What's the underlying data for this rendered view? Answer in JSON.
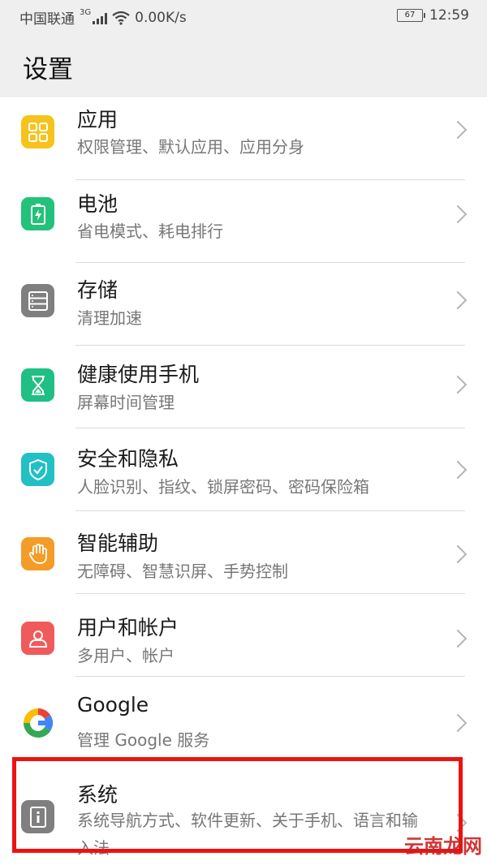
{
  "status_bar": {
    "carrier": "中国联通",
    "net_type": "3G",
    "speed": "0.00K/s",
    "battery": "67",
    "time": "12:59"
  },
  "header": {
    "title": "设置"
  },
  "items": [
    {
      "title": "应用",
      "subtitle": "权限管理、默认应用、应用分身",
      "icon": "apps-grid-icon",
      "color": "#f6c31c"
    },
    {
      "title": "电池",
      "subtitle": "省电模式、耗电排行",
      "icon": "battery-icon",
      "color": "#22c27a"
    },
    {
      "title": "存储",
      "subtitle": "清理加速",
      "icon": "storage-icon",
      "color": "#7f7f7f"
    },
    {
      "title": "健康使用手机",
      "subtitle": "屏幕时间管理",
      "icon": "hourglass-icon",
      "color": "#20bf84"
    },
    {
      "title": "安全和隐私",
      "subtitle": "人脸识别、指纹、锁屏密码、密码保险箱",
      "icon": "shield-icon",
      "color": "#22c0c4"
    },
    {
      "title": "智能辅助",
      "subtitle": "无障碍、智慧识屏、手势控制",
      "icon": "hand-icon",
      "color": "#f39c27"
    },
    {
      "title": "用户和帐户",
      "subtitle": "多用户、帐户",
      "icon": "user-icon",
      "color": "#f05a5a"
    },
    {
      "title": "Google",
      "subtitle": "管理 Google 服务",
      "icon": "google-icon",
      "color": "#ffffff"
    },
    {
      "title": "系统",
      "subtitle": "系统导航方式、软件更新、关于手机、语言和输入法",
      "icon": "system-info-icon",
      "color": "#7f7f7f"
    }
  ],
  "watermark": {
    "text": "云南龙网"
  }
}
